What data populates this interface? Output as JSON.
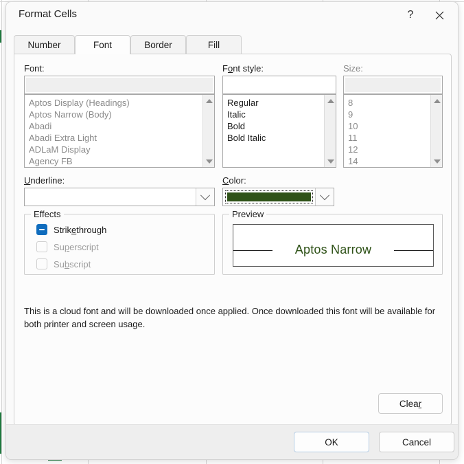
{
  "window": {
    "title": "Format Cells",
    "help_label": "?",
    "close_label": "✕"
  },
  "tabs": [
    {
      "label": "Number",
      "selected": false
    },
    {
      "label": "Font",
      "selected": true
    },
    {
      "label": "Border",
      "selected": false
    },
    {
      "label": "Fill",
      "selected": false
    }
  ],
  "font_section": {
    "label": "Font:",
    "input_value": "",
    "items": [
      "Aptos Display (Headings)",
      "Aptos Narrow (Body)",
      "Abadi",
      "Abadi Extra Light",
      "ADLaM Display",
      "Agency FB"
    ]
  },
  "font_style_section": {
    "label_prefix": "F",
    "label_accel": "o",
    "label_suffix": "nt style:",
    "input_value": "",
    "items": [
      "Regular",
      "Italic",
      "Bold",
      "Bold Italic"
    ]
  },
  "size_section": {
    "label": "Size:",
    "input_value": "",
    "items": [
      "8",
      "9",
      "10",
      "11",
      "12",
      "14"
    ]
  },
  "underline_section": {
    "label_prefix": "",
    "label_accel": "U",
    "label_suffix": "nderline:",
    "value": ""
  },
  "color_section": {
    "label_prefix": "",
    "label_accel": "C",
    "label_suffix": "olor:",
    "swatch_color": "#2f5218"
  },
  "effects": {
    "legend": "Effects",
    "items": [
      {
        "label_pre": "Strik",
        "label_accel": "e",
        "label_post": "through",
        "state": "indeterminate",
        "disabled": false
      },
      {
        "label_pre": "Su",
        "label_accel": "p",
        "label_post": "erscript",
        "state": "unchecked",
        "disabled": true
      },
      {
        "label_pre": "Su",
        "label_accel": "b",
        "label_post": "script",
        "state": "unchecked",
        "disabled": true
      }
    ]
  },
  "preview": {
    "legend": "Preview",
    "text": "Aptos Narrow",
    "text_color": "#2f5218",
    "strikethrough": true
  },
  "note": {
    "line1": "This is a cloud font and will be downloaded once applied. Once downloaded this font will be available for",
    "line2": "both printer and screen usage."
  },
  "buttons": {
    "clear_pre": "Clea",
    "clear_accel": "r",
    "clear_post": "",
    "ok": "OK",
    "cancel": "Cancel"
  }
}
